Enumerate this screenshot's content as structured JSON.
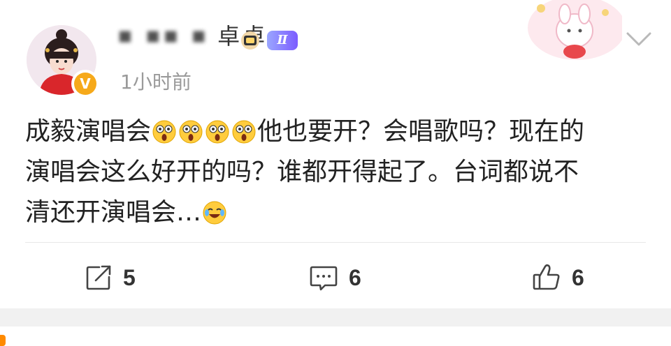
{
  "post": {
    "author_name_visible": "卓卓",
    "time": "1小时前",
    "level_badge": "Ⅱ",
    "verified_badge": "V",
    "content_lines": [
      [
        "成毅演唱会",
        "😲😲😲😲",
        "他也要开？会唱歌吗？现在的"
      ],
      [
        "演唱会这么好开的吗？谁都开得起了。台词都说不"
      ],
      [
        "清还开演唱会…",
        "😂"
      ]
    ]
  },
  "actions": {
    "repost_count": "5",
    "comment_count": "6",
    "like_count": "6"
  },
  "icons": {
    "repost": "repost-icon",
    "comment": "comment-icon",
    "like": "thumbs-up-icon",
    "menu": "chevron-down-icon",
    "avatar": "avatar-image",
    "verified": "verified-badge-icon"
  },
  "colors": {
    "accent_orange": "#f6a91a",
    "text": "#222222",
    "muted": "#9a9a9a"
  }
}
